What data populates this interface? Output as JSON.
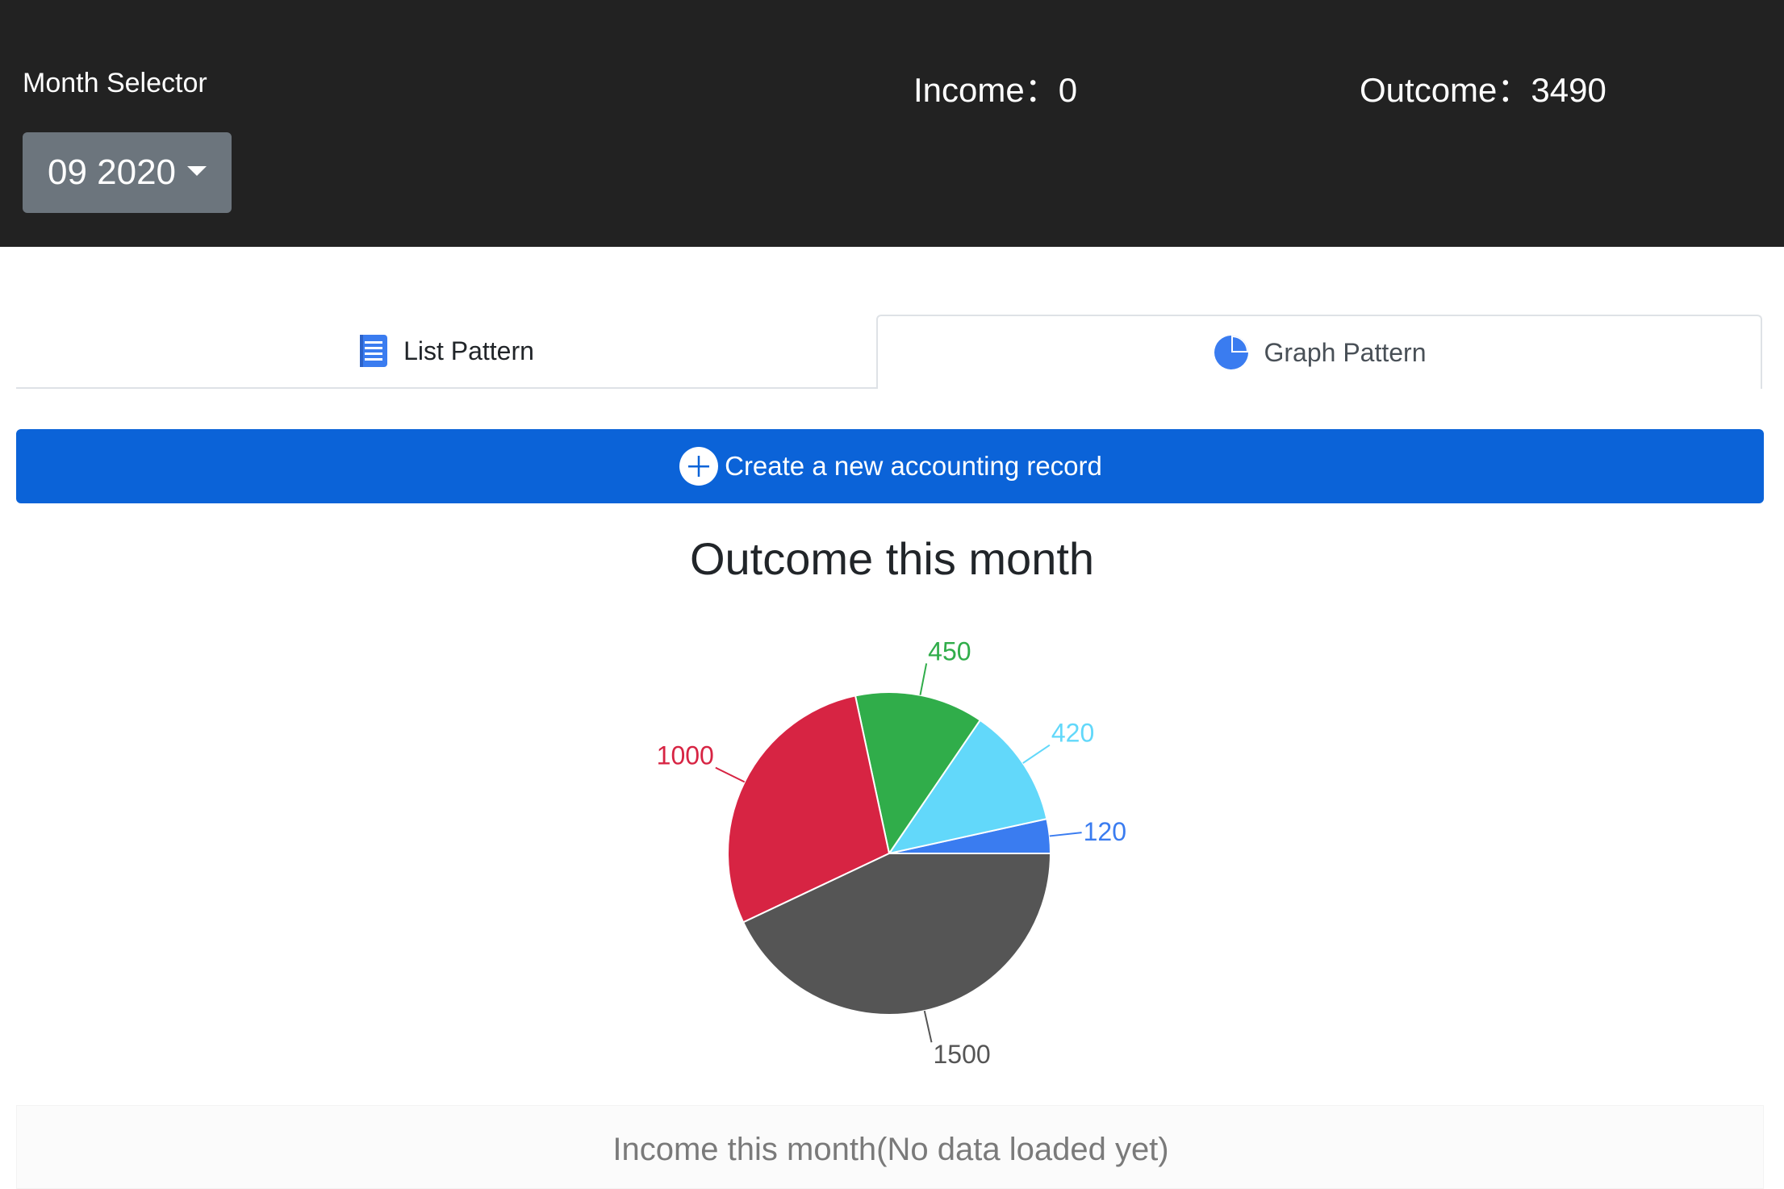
{
  "header": {
    "month_label": "Month Selector",
    "month_value": "09 2020",
    "income_text": "Income：0",
    "outcome_text": "Outcome：3490"
  },
  "tabs": [
    {
      "label": "List Pattern",
      "icon": "list-document-icon",
      "active": false
    },
    {
      "label": "Graph Pattern",
      "icon": "pie-chart-icon",
      "active": true
    }
  ],
  "create_button": {
    "label": "Create a new accounting record",
    "icon": "plus-circle-icon"
  },
  "colors": {
    "header_bg": "#222222",
    "primary": "#0b63d8",
    "tab_icon": "#3a7cf0",
    "month_button": "#6c757d"
  },
  "chart_data": {
    "type": "pie",
    "title": "Outcome this month",
    "slices": [
      {
        "value": 120,
        "label": "120",
        "color": "#3a7cf0"
      },
      {
        "value": 420,
        "label": "420",
        "color": "#62d8fa"
      },
      {
        "value": 450,
        "label": "450",
        "color": "#30ad4a"
      },
      {
        "value": 1000,
        "label": "1000",
        "color": "#d72443"
      },
      {
        "value": 1500,
        "label": "1500",
        "color": "#555555"
      }
    ]
  },
  "income_panel": {
    "text": "Income this month(No data loaded yet)"
  }
}
